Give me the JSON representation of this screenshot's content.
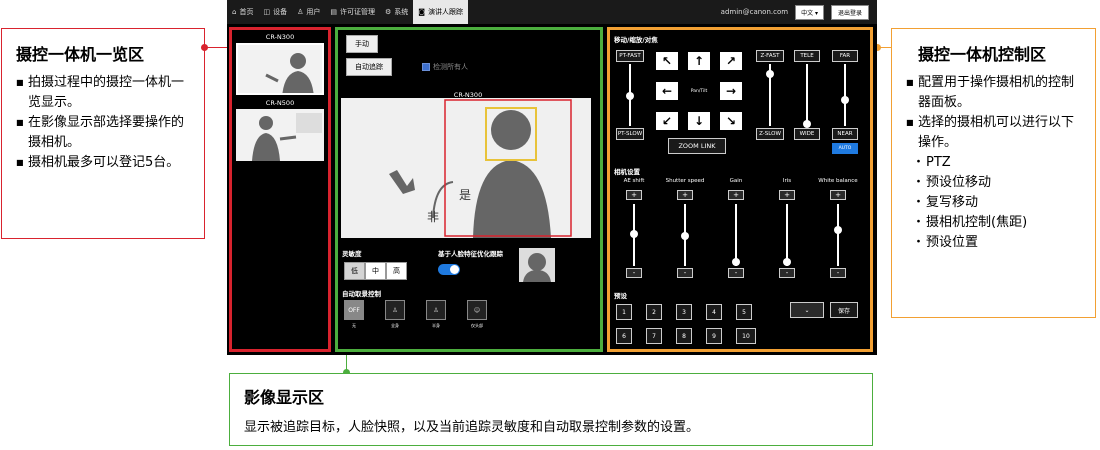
{
  "nav": {
    "items": [
      {
        "icon": "home-icon",
        "label": "首页"
      },
      {
        "icon": "device-icon",
        "label": "设备"
      },
      {
        "icon": "user-icon",
        "label": "用户"
      },
      {
        "icon": "license-icon",
        "label": "许可证管理"
      },
      {
        "icon": "gear-icon",
        "label": "系统"
      },
      {
        "icon": "camera-icon",
        "label": "演讲人跟踪"
      }
    ],
    "user": "admin@canon.com",
    "language": "中文 ▾",
    "logout": "退出登录"
  },
  "cam_list": {
    "cams": [
      {
        "name": "CR-N300"
      },
      {
        "name": "CR-N500"
      }
    ]
  },
  "video": {
    "manual": "手动",
    "auto_track": "自动追踪",
    "detect_all": "检测所有人",
    "cam_name": "CR-N300",
    "overlay_yes": "是",
    "overlay_no": "非",
    "sensitivity_label": "灵敏度",
    "sensitivity": [
      "低",
      "中",
      "高"
    ],
    "face_track_label": "基于人脸特征优化跟踪",
    "framing_label": "自动取景控制",
    "framing": [
      {
        "icon": "OFF",
        "label": "无"
      },
      {
        "icon": "full-body-icon",
        "label": "全身"
      },
      {
        "icon": "half-body-icon",
        "label": "半身"
      },
      {
        "icon": "head-icon",
        "label": "仅头部"
      }
    ]
  },
  "ctrl": {
    "ptz_label": "移动/缩放/对焦",
    "pt_fast": "PT-FAST",
    "pt_slow": "PT-SLOW",
    "pantilt": "Pan/Tilt",
    "zoom_link": "ZOOM LINK",
    "z_fast": "Z-FAST",
    "z_slow": "Z-SLOW",
    "tele": "TELE",
    "wide": "WIDE",
    "far": "FAR",
    "near": "NEAR",
    "auto": "AUTO",
    "cam_settings": "相机设置",
    "params": [
      "AE shift",
      "Shutter speed",
      "Gain",
      "Iris",
      "White balance"
    ],
    "plus": "+",
    "minus": "-",
    "preset_label": "预设",
    "presets": [
      "1",
      "2",
      "3",
      "4",
      "5",
      "6",
      "7",
      "8",
      "9",
      "10"
    ],
    "save": "保存",
    "dropdown": "⌄"
  },
  "callouts": {
    "list_title": "摄控一体机一览区",
    "list_items": [
      "拍摄过程中的摄控一体机一览显示。",
      "在影像显示部选择要操作的摄相机。",
      "摄相机最多可以登记5台。"
    ],
    "ctrl_title": "摄控一体机控制区",
    "ctrl_items": [
      "配置用于操作摄相机的控制器面板。",
      "选择的摄相机可以进行以下操作。"
    ],
    "ctrl_sub": [
      "PTZ",
      "预设位移动",
      "复写移动",
      "摄相机控制(焦距)",
      "预设位置"
    ],
    "video_title": "影像显示区",
    "video_desc": "显示被追踪目标，人脸快照，以及当前追踪灵敏度和自动取景控制参数的设置。"
  },
  "colors": {
    "list": "#d9232e",
    "video": "#4cae3e",
    "ctrl": "#f2a033",
    "face_box": "#e8c33a",
    "toggle": "#1f7ae0"
  }
}
